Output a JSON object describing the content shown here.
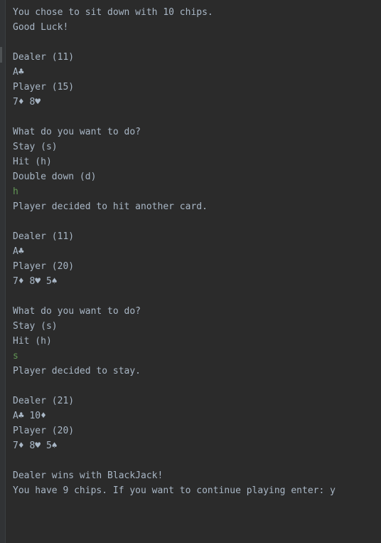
{
  "console": {
    "colors": {
      "background": "#2b2b2b",
      "text": "#a9b7c6",
      "user_input": "#629755"
    },
    "cutoff_text": "·····-··········-·········",
    "lines": [
      {
        "text": "You chose to sit down with 10 chips.",
        "kind": "output"
      },
      {
        "text": "Good Luck!",
        "kind": "output"
      },
      {
        "text": "",
        "kind": "blank"
      },
      {
        "text": "Dealer (11)",
        "kind": "output"
      },
      {
        "text": "A♣",
        "kind": "output"
      },
      {
        "text": "Player (15)",
        "kind": "output"
      },
      {
        "text": "7♦ 8♥",
        "kind": "output"
      },
      {
        "text": "",
        "kind": "blank"
      },
      {
        "text": "What do you want to do?",
        "kind": "output"
      },
      {
        "text": "Stay (s)",
        "kind": "output"
      },
      {
        "text": "Hit (h)",
        "kind": "output"
      },
      {
        "text": "Double down (d)",
        "kind": "output"
      },
      {
        "text": "h",
        "kind": "input"
      },
      {
        "text": "Player decided to hit another card.",
        "kind": "output"
      },
      {
        "text": "",
        "kind": "blank"
      },
      {
        "text": "Dealer (11)",
        "kind": "output"
      },
      {
        "text": "A♣",
        "kind": "output"
      },
      {
        "text": "Player (20)",
        "kind": "output"
      },
      {
        "text": "7♦ 8♥ 5♠",
        "kind": "output"
      },
      {
        "text": "",
        "kind": "blank"
      },
      {
        "text": "What do you want to do?",
        "kind": "output"
      },
      {
        "text": "Stay (s)",
        "kind": "output"
      },
      {
        "text": "Hit (h)",
        "kind": "output"
      },
      {
        "text": "s",
        "kind": "input"
      },
      {
        "text": "Player decided to stay.",
        "kind": "output"
      },
      {
        "text": "",
        "kind": "blank"
      },
      {
        "text": "Dealer (21)",
        "kind": "output"
      },
      {
        "text": "A♣ 10♦",
        "kind": "output"
      },
      {
        "text": "Player (20)",
        "kind": "output"
      },
      {
        "text": "7♦ 8♥ 5♠",
        "kind": "output"
      },
      {
        "text": "",
        "kind": "blank"
      },
      {
        "text": "Dealer wins with BlackJack!",
        "kind": "output"
      },
      {
        "text": "You have 9 chips. If you want to continue playing enter: y",
        "kind": "output"
      }
    ]
  }
}
